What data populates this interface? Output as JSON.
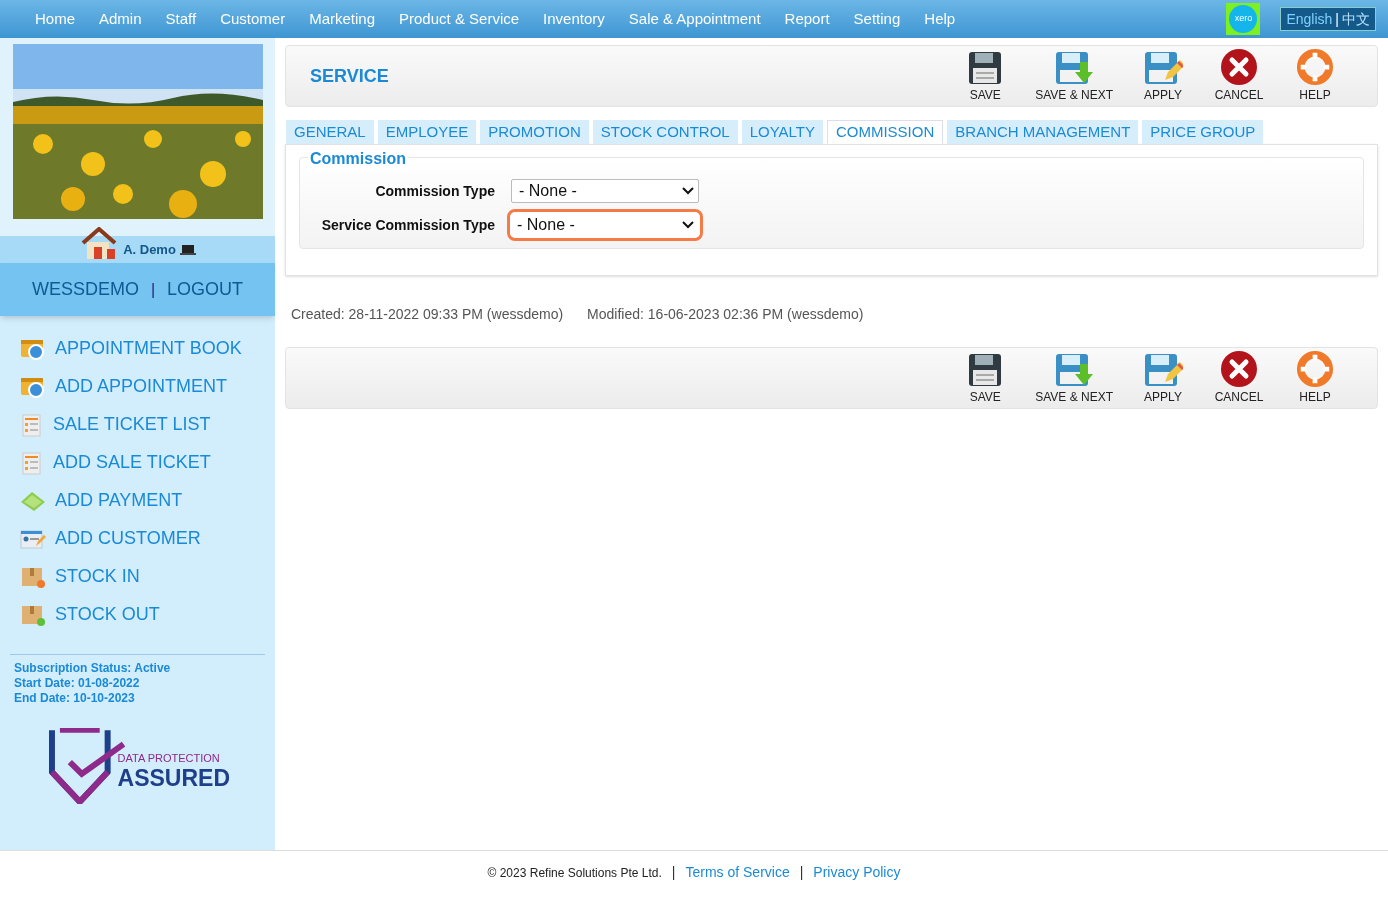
{
  "top_nav": {
    "items": [
      "Home",
      "Admin",
      "Staff",
      "Customer",
      "Marketing",
      "Product & Service",
      "Inventory",
      "Sale & Appointment",
      "Report",
      "Setting",
      "Help"
    ],
    "xero_logo": "xero",
    "languages": [
      {
        "label": "English",
        "selected": true
      },
      {
        "label": "中文",
        "selected": false
      }
    ],
    "language_separator": "|"
  },
  "sidebar": {
    "user_name": "A. Demo",
    "account": "WESSDEMO",
    "separator": "|",
    "logout": "LOGOUT",
    "items": [
      {
        "label": "APPOINTMENT BOOK",
        "kind": "calendar"
      },
      {
        "label": "ADD APPOINTMENT",
        "kind": "calendar"
      },
      {
        "label": "SALE TICKET LIST",
        "kind": "ticket"
      },
      {
        "label": "ADD SALE TICKET",
        "kind": "ticket"
      },
      {
        "label": "ADD PAYMENT",
        "kind": "payment"
      },
      {
        "label": "ADD CUSTOMER",
        "kind": "customer"
      },
      {
        "label": "STOCK IN",
        "kind": "stock_in"
      },
      {
        "label": "STOCK OUT",
        "kind": "stock_out"
      }
    ],
    "subscription": [
      "Subscription Status: Active",
      "Start Date: 01-08-2022",
      "End Date: 10-10-2023"
    ],
    "badge": {
      "small": "DATA PROTECTION",
      "large": "ASSURED"
    }
  },
  "page": {
    "title": "SERVICE",
    "toolbar_top": [
      {
        "label": "SAVE",
        "kind": "save"
      },
      {
        "label": "SAVE & NEXT",
        "kind": "save_next"
      },
      {
        "label": "APPLY",
        "kind": "apply"
      },
      {
        "label": "CANCEL",
        "kind": "cancel"
      },
      {
        "label": "HELP",
        "kind": "help"
      }
    ],
    "tabs": [
      {
        "label": "GENERAL",
        "selected": false
      },
      {
        "label": "EMPLOYEE",
        "selected": false
      },
      {
        "label": "PROMOTION",
        "selected": false
      },
      {
        "label": "STOCK CONTROL",
        "selected": false
      },
      {
        "label": "LOYALTY",
        "selected": false
      },
      {
        "label": "COMMISSION",
        "selected": true
      },
      {
        "label": "BRANCH MANAGEMENT",
        "selected": false
      },
      {
        "label": "PRICE GROUP",
        "selected": false
      }
    ],
    "section": {
      "legend": "Commission",
      "fields": [
        {
          "label": "Commission Type",
          "value": "- None -",
          "focused": false
        },
        {
          "label": "Service Commission Type",
          "value": "- None -",
          "focused": true
        }
      ]
    },
    "created": "Created: 28-11-2022 09:33 PM (wessdemo)",
    "modified": "Modified: 16-06-2023 02:36 PM (wessdemo)",
    "toolbar_bottom": [
      {
        "label": "SAVE",
        "kind": "save"
      },
      {
        "label": "SAVE & NEXT",
        "kind": "save_next"
      },
      {
        "label": "APPLY",
        "kind": "apply"
      },
      {
        "label": "CANCEL",
        "kind": "cancel"
      },
      {
        "label": "HELP",
        "kind": "help"
      }
    ]
  },
  "footer": {
    "copyright": "© 2023 Refine Solutions Pte Ltd.",
    "separators": [
      "|",
      "|"
    ],
    "links": [
      "Terms of Service",
      "Privacy Policy"
    ]
  }
}
